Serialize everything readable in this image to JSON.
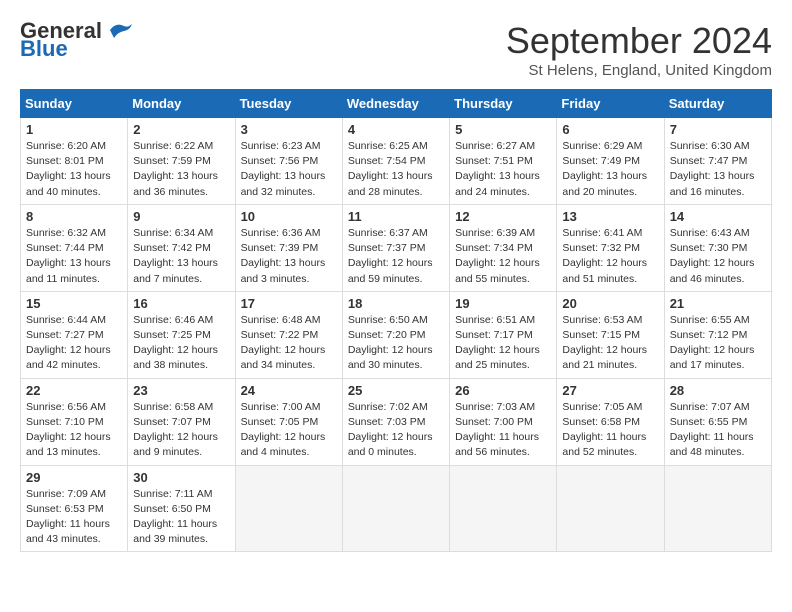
{
  "header": {
    "logo_general": "General",
    "logo_blue": "Blue",
    "month_title": "September 2024",
    "subtitle": "St Helens, England, United Kingdom"
  },
  "weekdays": [
    "Sunday",
    "Monday",
    "Tuesday",
    "Wednesday",
    "Thursday",
    "Friday",
    "Saturday"
  ],
  "weeks": [
    [
      {
        "day": "1",
        "lines": [
          "Sunrise: 6:20 AM",
          "Sunset: 8:01 PM",
          "Daylight: 13 hours",
          "and 40 minutes."
        ]
      },
      {
        "day": "2",
        "lines": [
          "Sunrise: 6:22 AM",
          "Sunset: 7:59 PM",
          "Daylight: 13 hours",
          "and 36 minutes."
        ]
      },
      {
        "day": "3",
        "lines": [
          "Sunrise: 6:23 AM",
          "Sunset: 7:56 PM",
          "Daylight: 13 hours",
          "and 32 minutes."
        ]
      },
      {
        "day": "4",
        "lines": [
          "Sunrise: 6:25 AM",
          "Sunset: 7:54 PM",
          "Daylight: 13 hours",
          "and 28 minutes."
        ]
      },
      {
        "day": "5",
        "lines": [
          "Sunrise: 6:27 AM",
          "Sunset: 7:51 PM",
          "Daylight: 13 hours",
          "and 24 minutes."
        ]
      },
      {
        "day": "6",
        "lines": [
          "Sunrise: 6:29 AM",
          "Sunset: 7:49 PM",
          "Daylight: 13 hours",
          "and 20 minutes."
        ]
      },
      {
        "day": "7",
        "lines": [
          "Sunrise: 6:30 AM",
          "Sunset: 7:47 PM",
          "Daylight: 13 hours",
          "and 16 minutes."
        ]
      }
    ],
    [
      {
        "day": "8",
        "lines": [
          "Sunrise: 6:32 AM",
          "Sunset: 7:44 PM",
          "Daylight: 13 hours",
          "and 11 minutes."
        ]
      },
      {
        "day": "9",
        "lines": [
          "Sunrise: 6:34 AM",
          "Sunset: 7:42 PM",
          "Daylight: 13 hours",
          "and 7 minutes."
        ]
      },
      {
        "day": "10",
        "lines": [
          "Sunrise: 6:36 AM",
          "Sunset: 7:39 PM",
          "Daylight: 13 hours",
          "and 3 minutes."
        ]
      },
      {
        "day": "11",
        "lines": [
          "Sunrise: 6:37 AM",
          "Sunset: 7:37 PM",
          "Daylight: 12 hours",
          "and 59 minutes."
        ]
      },
      {
        "day": "12",
        "lines": [
          "Sunrise: 6:39 AM",
          "Sunset: 7:34 PM",
          "Daylight: 12 hours",
          "and 55 minutes."
        ]
      },
      {
        "day": "13",
        "lines": [
          "Sunrise: 6:41 AM",
          "Sunset: 7:32 PM",
          "Daylight: 12 hours",
          "and 51 minutes."
        ]
      },
      {
        "day": "14",
        "lines": [
          "Sunrise: 6:43 AM",
          "Sunset: 7:30 PM",
          "Daylight: 12 hours",
          "and 46 minutes."
        ]
      }
    ],
    [
      {
        "day": "15",
        "lines": [
          "Sunrise: 6:44 AM",
          "Sunset: 7:27 PM",
          "Daylight: 12 hours",
          "and 42 minutes."
        ]
      },
      {
        "day": "16",
        "lines": [
          "Sunrise: 6:46 AM",
          "Sunset: 7:25 PM",
          "Daylight: 12 hours",
          "and 38 minutes."
        ]
      },
      {
        "day": "17",
        "lines": [
          "Sunrise: 6:48 AM",
          "Sunset: 7:22 PM",
          "Daylight: 12 hours",
          "and 34 minutes."
        ]
      },
      {
        "day": "18",
        "lines": [
          "Sunrise: 6:50 AM",
          "Sunset: 7:20 PM",
          "Daylight: 12 hours",
          "and 30 minutes."
        ]
      },
      {
        "day": "19",
        "lines": [
          "Sunrise: 6:51 AM",
          "Sunset: 7:17 PM",
          "Daylight: 12 hours",
          "and 25 minutes."
        ]
      },
      {
        "day": "20",
        "lines": [
          "Sunrise: 6:53 AM",
          "Sunset: 7:15 PM",
          "Daylight: 12 hours",
          "and 21 minutes."
        ]
      },
      {
        "day": "21",
        "lines": [
          "Sunrise: 6:55 AM",
          "Sunset: 7:12 PM",
          "Daylight: 12 hours",
          "and 17 minutes."
        ]
      }
    ],
    [
      {
        "day": "22",
        "lines": [
          "Sunrise: 6:56 AM",
          "Sunset: 7:10 PM",
          "Daylight: 12 hours",
          "and 13 minutes."
        ]
      },
      {
        "day": "23",
        "lines": [
          "Sunrise: 6:58 AM",
          "Sunset: 7:07 PM",
          "Daylight: 12 hours",
          "and 9 minutes."
        ]
      },
      {
        "day": "24",
        "lines": [
          "Sunrise: 7:00 AM",
          "Sunset: 7:05 PM",
          "Daylight: 12 hours",
          "and 4 minutes."
        ]
      },
      {
        "day": "25",
        "lines": [
          "Sunrise: 7:02 AM",
          "Sunset: 7:03 PM",
          "Daylight: 12 hours",
          "and 0 minutes."
        ]
      },
      {
        "day": "26",
        "lines": [
          "Sunrise: 7:03 AM",
          "Sunset: 7:00 PM",
          "Daylight: 11 hours",
          "and 56 minutes."
        ]
      },
      {
        "day": "27",
        "lines": [
          "Sunrise: 7:05 AM",
          "Sunset: 6:58 PM",
          "Daylight: 11 hours",
          "and 52 minutes."
        ]
      },
      {
        "day": "28",
        "lines": [
          "Sunrise: 7:07 AM",
          "Sunset: 6:55 PM",
          "Daylight: 11 hours",
          "and 48 minutes."
        ]
      }
    ],
    [
      {
        "day": "29",
        "lines": [
          "Sunrise: 7:09 AM",
          "Sunset: 6:53 PM",
          "Daylight: 11 hours",
          "and 43 minutes."
        ]
      },
      {
        "day": "30",
        "lines": [
          "Sunrise: 7:11 AM",
          "Sunset: 6:50 PM",
          "Daylight: 11 hours",
          "and 39 minutes."
        ]
      },
      null,
      null,
      null,
      null,
      null
    ]
  ]
}
